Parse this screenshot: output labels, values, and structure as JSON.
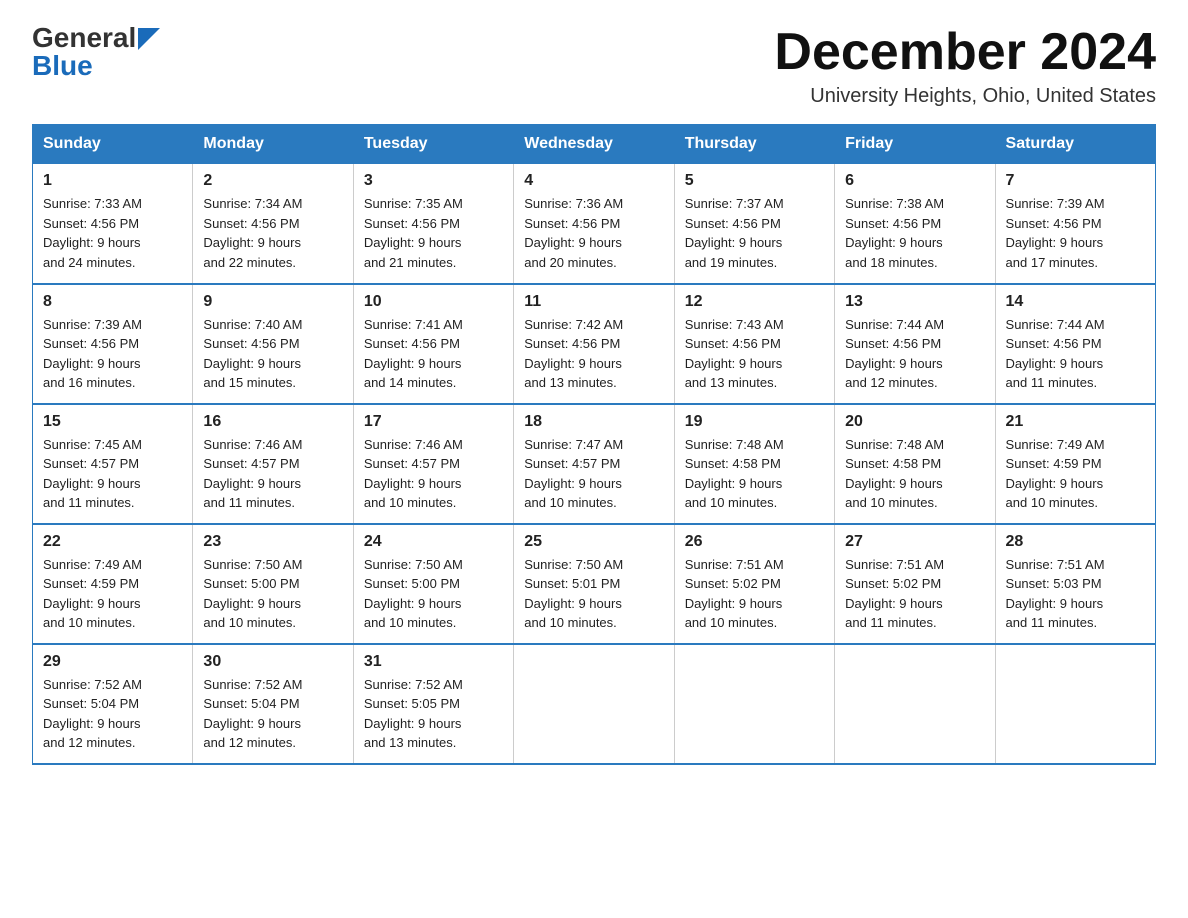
{
  "header": {
    "logo_general": "General",
    "logo_blue": "Blue",
    "month_title": "December 2024",
    "location": "University Heights, Ohio, United States"
  },
  "days_of_week": [
    "Sunday",
    "Monday",
    "Tuesday",
    "Wednesday",
    "Thursday",
    "Friday",
    "Saturday"
  ],
  "weeks": [
    [
      {
        "day": "1",
        "sunrise": "7:33 AM",
        "sunset": "4:56 PM",
        "daylight": "9 hours and 24 minutes."
      },
      {
        "day": "2",
        "sunrise": "7:34 AM",
        "sunset": "4:56 PM",
        "daylight": "9 hours and 22 minutes."
      },
      {
        "day": "3",
        "sunrise": "7:35 AM",
        "sunset": "4:56 PM",
        "daylight": "9 hours and 21 minutes."
      },
      {
        "day": "4",
        "sunrise": "7:36 AM",
        "sunset": "4:56 PM",
        "daylight": "9 hours and 20 minutes."
      },
      {
        "day": "5",
        "sunrise": "7:37 AM",
        "sunset": "4:56 PM",
        "daylight": "9 hours and 19 minutes."
      },
      {
        "day": "6",
        "sunrise": "7:38 AM",
        "sunset": "4:56 PM",
        "daylight": "9 hours and 18 minutes."
      },
      {
        "day": "7",
        "sunrise": "7:39 AM",
        "sunset": "4:56 PM",
        "daylight": "9 hours and 17 minutes."
      }
    ],
    [
      {
        "day": "8",
        "sunrise": "7:39 AM",
        "sunset": "4:56 PM",
        "daylight": "9 hours and 16 minutes."
      },
      {
        "day": "9",
        "sunrise": "7:40 AM",
        "sunset": "4:56 PM",
        "daylight": "9 hours and 15 minutes."
      },
      {
        "day": "10",
        "sunrise": "7:41 AM",
        "sunset": "4:56 PM",
        "daylight": "9 hours and 14 minutes."
      },
      {
        "day": "11",
        "sunrise": "7:42 AM",
        "sunset": "4:56 PM",
        "daylight": "9 hours and 13 minutes."
      },
      {
        "day": "12",
        "sunrise": "7:43 AM",
        "sunset": "4:56 PM",
        "daylight": "9 hours and 13 minutes."
      },
      {
        "day": "13",
        "sunrise": "7:44 AM",
        "sunset": "4:56 PM",
        "daylight": "9 hours and 12 minutes."
      },
      {
        "day": "14",
        "sunrise": "7:44 AM",
        "sunset": "4:56 PM",
        "daylight": "9 hours and 11 minutes."
      }
    ],
    [
      {
        "day": "15",
        "sunrise": "7:45 AM",
        "sunset": "4:57 PM",
        "daylight": "9 hours and 11 minutes."
      },
      {
        "day": "16",
        "sunrise": "7:46 AM",
        "sunset": "4:57 PM",
        "daylight": "9 hours and 11 minutes."
      },
      {
        "day": "17",
        "sunrise": "7:46 AM",
        "sunset": "4:57 PM",
        "daylight": "9 hours and 10 minutes."
      },
      {
        "day": "18",
        "sunrise": "7:47 AM",
        "sunset": "4:57 PM",
        "daylight": "9 hours and 10 minutes."
      },
      {
        "day": "19",
        "sunrise": "7:48 AM",
        "sunset": "4:58 PM",
        "daylight": "9 hours and 10 minutes."
      },
      {
        "day": "20",
        "sunrise": "7:48 AM",
        "sunset": "4:58 PM",
        "daylight": "9 hours and 10 minutes."
      },
      {
        "day": "21",
        "sunrise": "7:49 AM",
        "sunset": "4:59 PM",
        "daylight": "9 hours and 10 minutes."
      }
    ],
    [
      {
        "day": "22",
        "sunrise": "7:49 AM",
        "sunset": "4:59 PM",
        "daylight": "9 hours and 10 minutes."
      },
      {
        "day": "23",
        "sunrise": "7:50 AM",
        "sunset": "5:00 PM",
        "daylight": "9 hours and 10 minutes."
      },
      {
        "day": "24",
        "sunrise": "7:50 AM",
        "sunset": "5:00 PM",
        "daylight": "9 hours and 10 minutes."
      },
      {
        "day": "25",
        "sunrise": "7:50 AM",
        "sunset": "5:01 PM",
        "daylight": "9 hours and 10 minutes."
      },
      {
        "day": "26",
        "sunrise": "7:51 AM",
        "sunset": "5:02 PM",
        "daylight": "9 hours and 10 minutes."
      },
      {
        "day": "27",
        "sunrise": "7:51 AM",
        "sunset": "5:02 PM",
        "daylight": "9 hours and 11 minutes."
      },
      {
        "day": "28",
        "sunrise": "7:51 AM",
        "sunset": "5:03 PM",
        "daylight": "9 hours and 11 minutes."
      }
    ],
    [
      {
        "day": "29",
        "sunrise": "7:52 AM",
        "sunset": "5:04 PM",
        "daylight": "9 hours and 12 minutes."
      },
      {
        "day": "30",
        "sunrise": "7:52 AM",
        "sunset": "5:04 PM",
        "daylight": "9 hours and 12 minutes."
      },
      {
        "day": "31",
        "sunrise": "7:52 AM",
        "sunset": "5:05 PM",
        "daylight": "9 hours and 13 minutes."
      },
      null,
      null,
      null,
      null
    ]
  ],
  "labels": {
    "sunrise": "Sunrise:",
    "sunset": "Sunset:",
    "daylight": "Daylight:"
  }
}
